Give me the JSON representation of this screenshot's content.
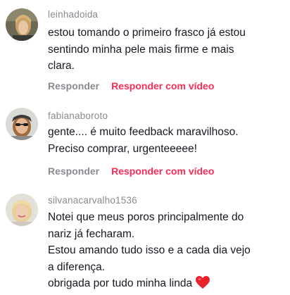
{
  "comments": [
    {
      "username": "leinhadoida",
      "text": "estou tomando o primeiro frasco já estou\nsentindo minha pele mais firme e mais\nclara.",
      "reply_label": "Responder",
      "reply_video_label": "Responder com vídeo"
    },
    {
      "username": "fabianaboroto",
      "text": "gente.... é muito feedback maravilhoso.\nPreciso comprar, urgenteeeee!",
      "reply_label": "Responder",
      "reply_video_label": "Responder com vídeo"
    },
    {
      "username": "silvanacarvalho1536",
      "text": "Notei que meus poros principalmente do\nnariz já fecharam.\nEstou amando tudo isso e a cada dia vejo\na diferença.\nobrigada por tudo minha linda",
      "emoji": "heart-emoji"
    }
  ],
  "colors": {
    "username": "#8a8b91",
    "text": "#161823",
    "reply": "#8a8b91",
    "reply_video": "#fe2c55",
    "heart": "#e8232e"
  }
}
